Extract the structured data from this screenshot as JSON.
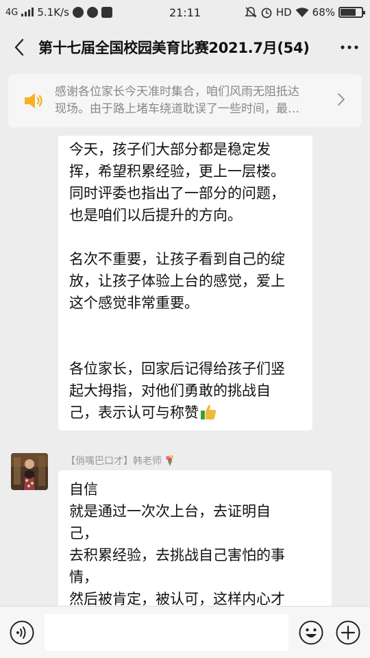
{
  "status_bar": {
    "network": "4G",
    "speed": "5.1K/s",
    "time": "21:11",
    "hd": "HD",
    "battery": "68%",
    "battery_level": 0.68
  },
  "header": {
    "title": "第十七届全国校园美育比赛2021.7月(54)"
  },
  "notice": {
    "line1": "感谢各位家长今天准时集合，咱们风雨无阻抵达",
    "line2": "现场。由于路上堵车绕道耽误了一些时间，最…"
  },
  "messages": [
    {
      "lines": [
        "今天，孩子们大部分都是稳定发",
        "挥，希望积累经验，更上一层楼。",
        "同时评委也指出了一部分的问题，",
        "也是咱们以后提升的方向。",
        "",
        "名次不重要，让孩子看到自己的绽",
        "放，让孩子体验上台的感觉，爱上",
        "这个感觉非常重要。",
        "",
        "",
        "各位家长，回家后记得给孩子们竖",
        "起大拇指，对他们勇敢的挑战自",
        "己，表示认可与称赞"
      ]
    },
    {
      "sender": "【俏嘴巴口才】韩老师",
      "lines": [
        "自信",
        "就是通过一次次上台，去证明自",
        "己，",
        "去积累经验，去挑战自己害怕的事",
        "情，",
        "然后被肯定，被认可，这样内心才"
      ]
    }
  ],
  "input": {
    "value": ""
  },
  "colors": {
    "page_bg": "#ededed",
    "notice_icon": "#f5b323",
    "thumb": "#f3b73a"
  }
}
